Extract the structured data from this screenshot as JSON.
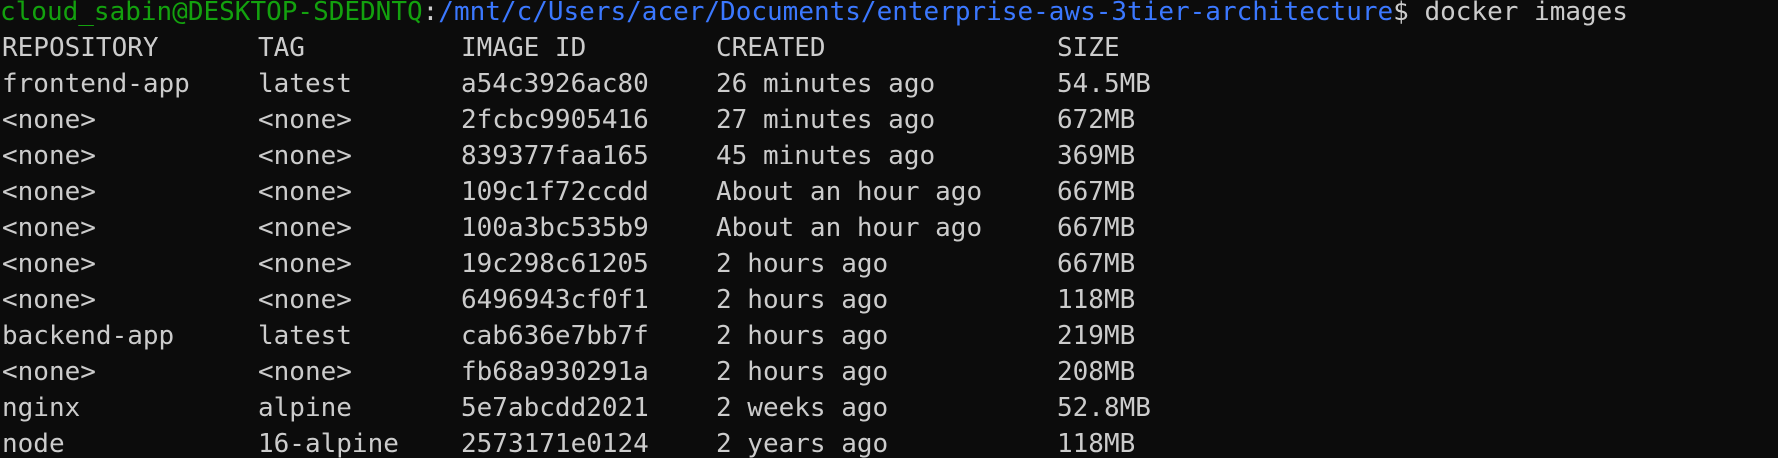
{
  "window": {
    "background": "#0c0c0c",
    "foreground": "#cccccc",
    "user_color": "#13a10e",
    "path_color": "#3b78ff"
  },
  "prompt": {
    "user_host": "cloud_sabin@DESKTOP-SDEDNTQ",
    "separator": ":",
    "path": "/mnt/c/Users/acer/Documents/enterprise-aws-3tier-architecture",
    "symbol": "$ ",
    "command": "docker images"
  },
  "table": {
    "headers": [
      "REPOSITORY",
      "TAG",
      "IMAGE ID",
      "CREATED",
      "SIZE"
    ],
    "rows": [
      [
        "frontend-app",
        "latest",
        "a54c3926ac80",
        "26 minutes ago",
        "54.5MB"
      ],
      [
        "<none>",
        "<none>",
        "2fcbc9905416",
        "27 minutes ago",
        "672MB"
      ],
      [
        "<none>",
        "<none>",
        "839377faa165",
        "45 minutes ago",
        "369MB"
      ],
      [
        "<none>",
        "<none>",
        "109c1f72ccdd",
        "About an hour ago",
        "667MB"
      ],
      [
        "<none>",
        "<none>",
        "100a3bc535b9",
        "About an hour ago",
        "667MB"
      ],
      [
        "<none>",
        "<none>",
        "19c298c61205",
        "2 hours ago",
        "667MB"
      ],
      [
        "<none>",
        "<none>",
        "6496943cf0f1",
        "2 hours ago",
        "118MB"
      ],
      [
        "backend-app",
        "latest",
        "cab636e7bb7f",
        "2 hours ago",
        "219MB"
      ],
      [
        "<none>",
        "<none>",
        "fb68a930291a",
        "2 hours ago",
        "208MB"
      ],
      [
        "nginx",
        "alpine",
        "5e7abcdd2021",
        "2 weeks ago",
        "52.8MB"
      ],
      [
        "node",
        "16-alpine",
        "2573171e0124",
        "2 years ago",
        "118MB"
      ]
    ]
  }
}
